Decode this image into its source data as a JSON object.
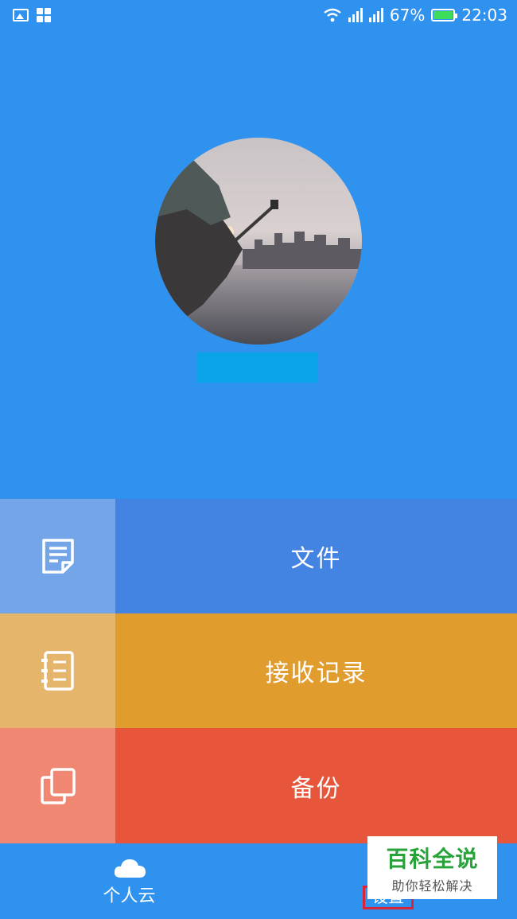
{
  "status_bar": {
    "battery": "67%",
    "time": "22:03",
    "icons": [
      "image-icon",
      "apps-icon",
      "wifi-icon",
      "signal-icon",
      "signal-icon",
      "battery-icon"
    ]
  },
  "profile": {
    "avatar_description": "photo-avatar"
  },
  "menu": {
    "items": [
      {
        "label": "文件",
        "icon": "document-icon"
      },
      {
        "label": "接收记录",
        "icon": "notebook-icon"
      },
      {
        "label": "备份",
        "icon": "copy-icon"
      }
    ]
  },
  "bottom_nav": {
    "cloud_label": "个人云",
    "settings_label": "设置",
    "cloud_icon": "cloud-icon"
  },
  "watermark": {
    "title": "百科全说",
    "subtitle": "助你轻松解决"
  },
  "colors": {
    "background": "#3092ef",
    "files_row": "#4383e2",
    "records_row": "#e19c2e",
    "backup_row": "#e7553a",
    "highlight_box": "#d8253a",
    "watermark_green": "#27a33a"
  }
}
